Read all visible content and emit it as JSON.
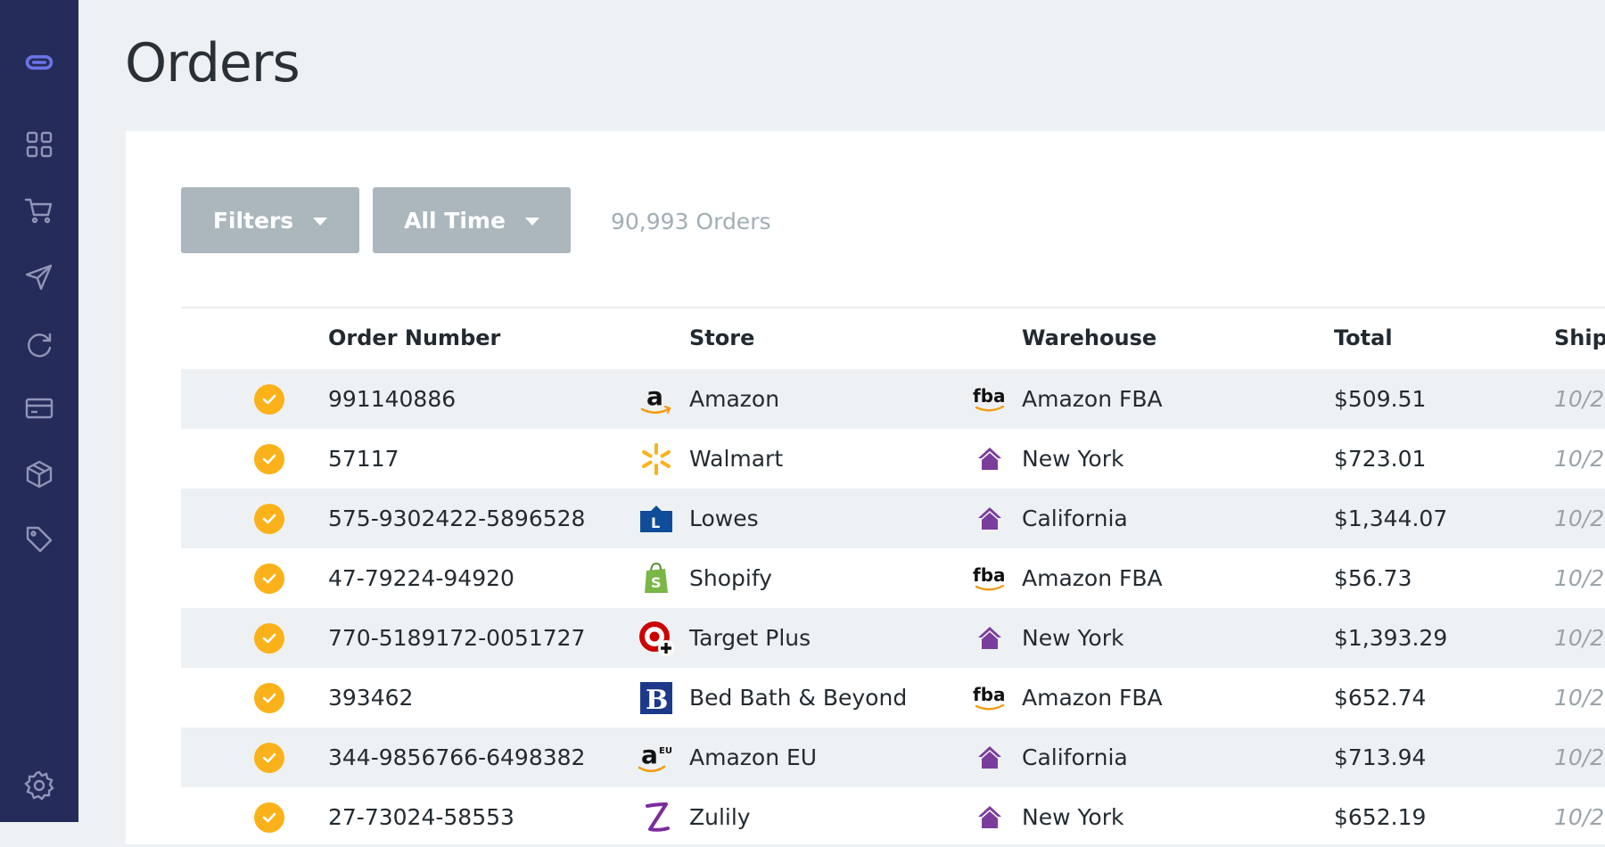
{
  "page": {
    "title": "Orders"
  },
  "sidebar": {
    "items": [
      {
        "icon": "link-logo-icon"
      },
      {
        "icon": "dashboard-grid-icon"
      },
      {
        "icon": "cart-icon"
      },
      {
        "icon": "send-icon"
      },
      {
        "icon": "refresh-icon"
      },
      {
        "icon": "credit-card-icon"
      },
      {
        "icon": "package-icon"
      },
      {
        "icon": "tag-icon"
      },
      {
        "icon": "settings-gear-icon"
      }
    ]
  },
  "toolbar": {
    "filters_label": "Filters",
    "time_label": "All Time",
    "order_count": "90,993 Orders"
  },
  "table": {
    "columns": [
      "Order Number",
      "Store",
      "Warehouse",
      "Total",
      "Ship"
    ],
    "rows": [
      {
        "order": "991140886",
        "store": "Amazon",
        "store_logo": "amazon-logo-icon",
        "warehouse": "Amazon FBA",
        "warehouse_icon": "fba-logo-icon",
        "total": "$509.51",
        "ship": "10/2"
      },
      {
        "order": "57117",
        "store": "Walmart",
        "store_logo": "walmart-logo-icon",
        "warehouse": "New York",
        "warehouse_icon": "warehouse-house-icon",
        "total": "$723.01",
        "ship": "10/2"
      },
      {
        "order": "575-9302422-5896528",
        "store": "Lowes",
        "store_logo": "lowes-logo-icon",
        "warehouse": "California",
        "warehouse_icon": "warehouse-house-icon",
        "total": "$1,344.07",
        "ship": "10/2"
      },
      {
        "order": "47-79224-94920",
        "store": "Shopify",
        "store_logo": "shopify-logo-icon",
        "warehouse": "Amazon FBA",
        "warehouse_icon": "fba-logo-icon",
        "total": "$56.73",
        "ship": "10/2"
      },
      {
        "order": "770-5189172-0051727",
        "store": "Target Plus",
        "store_logo": "target-plus-logo-icon",
        "warehouse": "New York",
        "warehouse_icon": "warehouse-house-icon",
        "total": "$1,393.29",
        "ship": "10/2"
      },
      {
        "order": "393462",
        "store": "Bed Bath & Beyond",
        "store_logo": "bed-bath-beyond-logo-icon",
        "warehouse": "Amazon FBA",
        "warehouse_icon": "fba-logo-icon",
        "total": "$652.74",
        "ship": "10/2"
      },
      {
        "order": "344-9856766-6498382",
        "store": "Amazon EU",
        "store_logo": "amazon-eu-logo-icon",
        "warehouse": "California",
        "warehouse_icon": "warehouse-house-icon",
        "total": "$713.94",
        "ship": "10/2"
      },
      {
        "order": "27-73024-58553",
        "store": "Zulily",
        "store_logo": "zulily-logo-icon",
        "warehouse": "New York",
        "warehouse_icon": "warehouse-house-icon",
        "total": "$652.19",
        "ship": "10/2"
      }
    ]
  },
  "colors": {
    "sidebar": "#252c5a",
    "accent": "#6b73e8",
    "check": "#fbb21a",
    "warehouse_purple": "#7b3d9b"
  }
}
